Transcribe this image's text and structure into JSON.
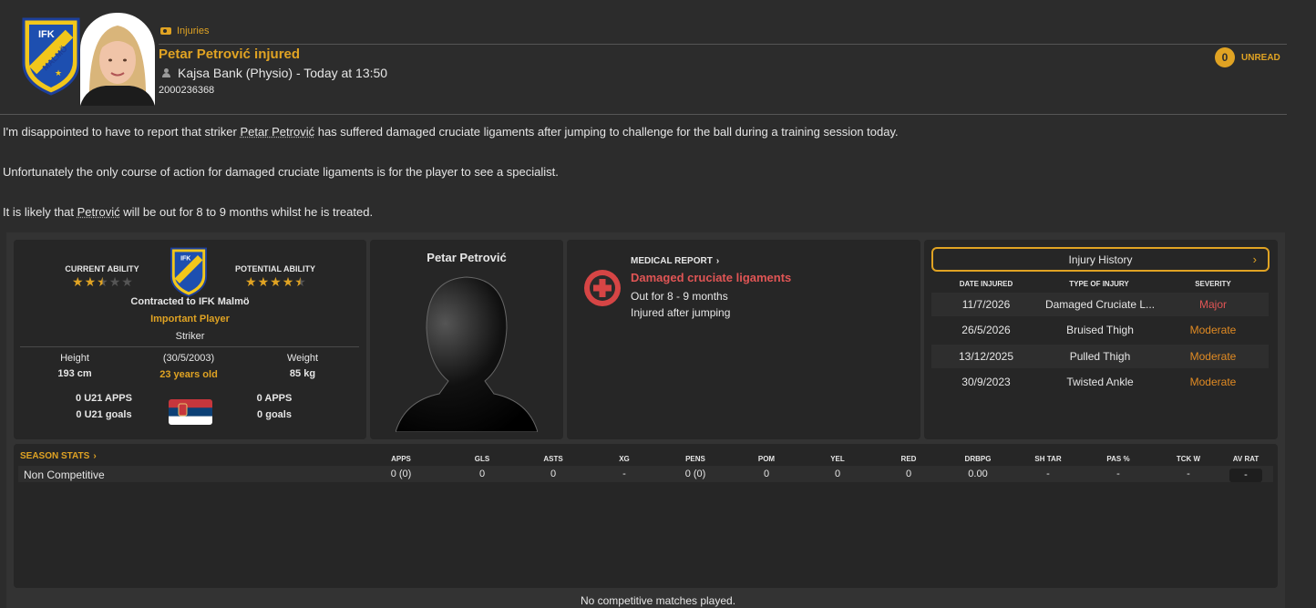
{
  "message": {
    "category": "Injuries",
    "subject": "Petar Petrović injured",
    "sender": "Kajsa Bank (Physio) - Today at 13:50",
    "id": "2000236368",
    "unread_count": "0",
    "unread_label": "UNREAD",
    "body": {
      "p1_a": "I'm disappointed to have to report that striker ",
      "p1_name": "Petar Petrović",
      "p1_b": " has suffered damaged cruciate ligaments after jumping to challenge for the ball during a training session today.",
      "p2": "Unfortunately the only course of action for damaged cruciate ligaments is for the player to see a specialist.",
      "p3_a": "It is likely that ",
      "p3_name": "Petrović",
      "p3_b": " will be out for 8 to 9 months whilst he is treated."
    }
  },
  "club": {
    "badge_text": "IFK MALMÖ"
  },
  "profile": {
    "current_ability_label": "CURRENT ABILITY",
    "potential_ability_label": "POTENTIAL ABILITY",
    "current_ability_stars": 2.5,
    "potential_ability_stars": 4.5,
    "contract": "Contracted to IFK Malmö",
    "status": "Important Player",
    "position": "Striker",
    "height_label": "Height",
    "height": "193 cm",
    "dob": "(30/5/2003)",
    "age": "23 years old",
    "weight_label": "Weight",
    "weight": "85 kg",
    "u21_apps": "0 U21 APPS",
    "u21_goals": "0 U21 goals",
    "apps": "0 APPS",
    "goals": "0 goals",
    "nationality_flag": "serbia-flag"
  },
  "player": {
    "name": "Petar Petrović"
  },
  "medical": {
    "link": "MEDICAL REPORT",
    "injury": "Damaged cruciate ligaments",
    "duration": "Out for 8 - 9 months",
    "cause": "Injured after jumping"
  },
  "history": {
    "button": "Injury History",
    "headers": [
      "DATE INJURED",
      "TYPE OF INJURY",
      "SEVERITY"
    ],
    "rows": [
      {
        "date": "11/7/2026",
        "type": "Damaged Cruciate L...",
        "severity": "Major"
      },
      {
        "date": "26/5/2026",
        "type": "Bruised Thigh",
        "severity": "Moderate"
      },
      {
        "date": "13/12/2025",
        "type": "Pulled Thigh",
        "severity": "Moderate"
      },
      {
        "date": "30/9/2023",
        "type": "Twisted Ankle",
        "severity": "Moderate"
      }
    ]
  },
  "stats": {
    "title": "SEASON STATS",
    "headers": [
      "APPS",
      "GLS",
      "ASTS",
      "XG",
      "PENS",
      "POM",
      "YEL",
      "RED",
      "DRBPG",
      "SH TAR",
      "PAS %",
      "TCK W",
      "AV RAT"
    ],
    "row_label": "Non Competitive",
    "values": [
      "0 (0)",
      "0",
      "0",
      "-",
      "0 (0)",
      "0",
      "0",
      "0",
      "0.00",
      "-",
      "-",
      "-",
      "-"
    ],
    "footer": "No competitive matches played."
  },
  "colors": {
    "accent": "#e0a323",
    "major": "#e05555",
    "moderate": "#e08a23",
    "bg": "#2c2c2c",
    "panel": "#262626"
  }
}
